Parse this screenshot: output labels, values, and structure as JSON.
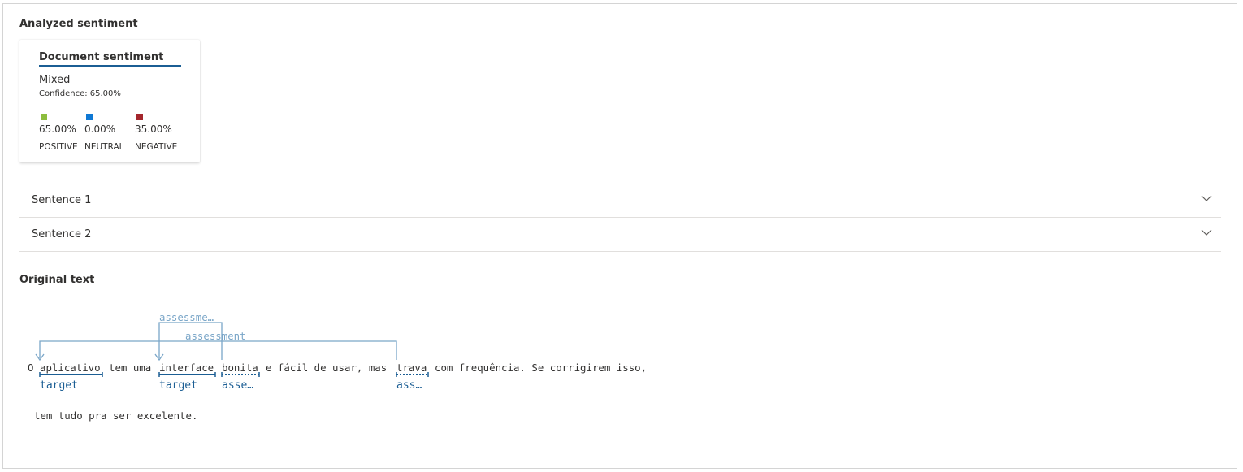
{
  "analyzed": {
    "title": "Analyzed sentiment",
    "card": {
      "title": "Document sentiment",
      "overall": "Mixed",
      "confidence": "Confidence: 65.00%",
      "scores": [
        {
          "value": "65.00%",
          "label": "POSITIVE",
          "color": "#8cbd3e"
        },
        {
          "value": "0.00%",
          "label": "NEUTRAL",
          "color": "#0f78d4"
        },
        {
          "value": "35.00%",
          "label": "NEGATIVE",
          "color": "#a4262c"
        }
      ]
    }
  },
  "sentences": [
    {
      "label": "Sentence 1"
    },
    {
      "label": "Sentence 2"
    }
  ],
  "original": {
    "title": "Original text",
    "line1_tokens": {
      "t0": "O",
      "t1": "aplicativo",
      "t2": "tem uma",
      "t3": "interface",
      "t4": "bonita",
      "t5": "e fácil de usar, mas",
      "t6": "trava",
      "t7": "com frequência. Se corrigirem isso,"
    },
    "tags": {
      "aplicativo": "target",
      "interface": "target",
      "bonita": "asse…",
      "trava": "ass…"
    },
    "relation_labels": {
      "top": "assessme…",
      "middle": "assessment"
    },
    "line2": "tem tudo pra ser excelente."
  },
  "colors": {
    "accent": "#1b5e94",
    "relation": "#7aa6c8"
  }
}
